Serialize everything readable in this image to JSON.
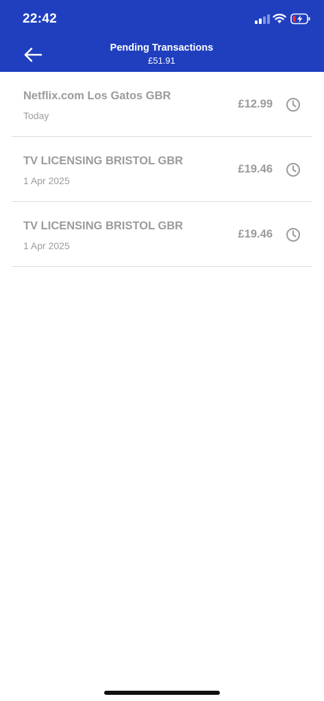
{
  "status_bar": {
    "time": "22:42"
  },
  "header": {
    "title": "Pending Transactions",
    "total": "£51.91"
  },
  "transactions": [
    {
      "merchant": "Netflix.com Los Gatos GBR",
      "date": "Today",
      "amount": "£12.99",
      "status_icon": "clock-icon"
    },
    {
      "merchant": "TV LICENSING BRISTOL GBR",
      "date": "1 Apr 2025",
      "amount": "£19.46",
      "status_icon": "clock-icon"
    },
    {
      "merchant": "TV LICENSING BRISTOL GBR",
      "date": "1 Apr 2025",
      "amount": "£19.46",
      "status_icon": "clock-icon"
    }
  ],
  "colors": {
    "header_bg": "#1f3fbf",
    "muted_text": "#9b9b9b",
    "divider": "#dcdcdc"
  }
}
